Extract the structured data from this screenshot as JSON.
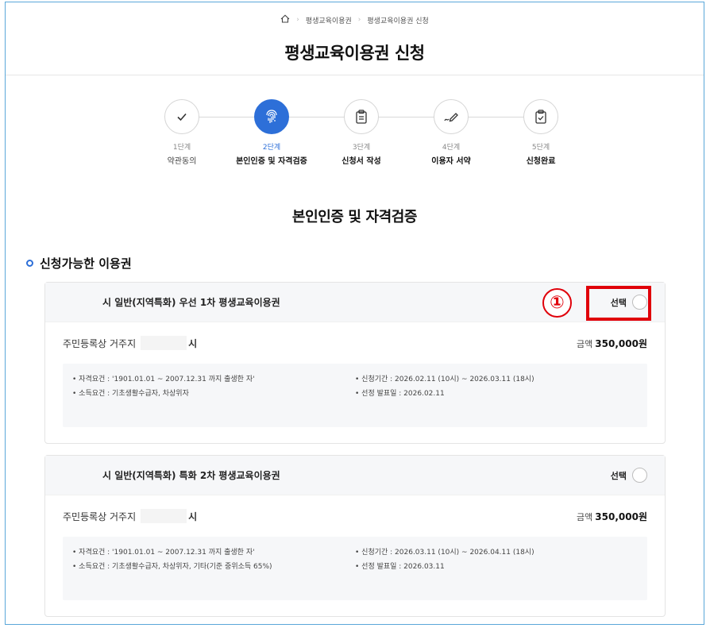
{
  "breadcrumb": {
    "items": [
      "평생교육이용권",
      "평생교육이용권 신청"
    ]
  },
  "page_title": "평생교육이용권 신청",
  "stepper": {
    "steps": [
      {
        "num": "1단계",
        "label": "약관동의",
        "icon": "check-icon",
        "state": "done"
      },
      {
        "num": "2단계",
        "label": "본인인증 및 자격검증",
        "icon": "fingerprint-icon",
        "state": "active"
      },
      {
        "num": "3단계",
        "label": "신청서 작성",
        "icon": "clipboard-icon",
        "state": "pending"
      },
      {
        "num": "4단계",
        "label": "이용자 서약",
        "icon": "pen-icon",
        "state": "pending"
      },
      {
        "num": "5단계",
        "label": "신청완료",
        "icon": "clipboard-check-icon",
        "state": "pending"
      }
    ]
  },
  "section_title": "본인인증 및 자격검증",
  "available_title": "신청가능한 이용권",
  "cards": [
    {
      "title": "시 일반(지역특화) 우선 1차 평생교육이용권",
      "select_label": "선택",
      "residence_label": "주민등록상 거주지",
      "residence_value": "시",
      "amount_label": "금액",
      "amount_value": "350,000원",
      "left_details": [
        "• 자격요건 : '1901.01.01 ~ 2007.12.31 까지 출생한 자'",
        "• 소득요건 : 기초생활수급자, 차상위자"
      ],
      "right_details": [
        "• 신청기간 : 2026.02.11 (10시) ~ 2026.03.11 (18시)",
        "• 선정 발표일 : 2026.02.11"
      ]
    },
    {
      "title": "시 일반(지역특화) 특화 2차 평생교육이용권",
      "select_label": "선택",
      "residence_label": "주민등록상 거주지",
      "residence_value": "시",
      "amount_label": "금액",
      "amount_value": "350,000원",
      "left_details": [
        "• 자격요건 : '1901.01.01 ~ 2007.12.31 까지 출생한 자'",
        "• 소득요건 : 기초생활수급자, 차상위자, 기타(기준 중위소득 65%)"
      ],
      "right_details": [
        "• 신청기간 : 2026.03.11 (10시) ~ 2026.04.11 (18시)",
        "• 선정 발표일 : 2026.03.11"
      ]
    }
  ],
  "annotation": {
    "marker": "①"
  },
  "colors": {
    "accent": "#2d6fd8",
    "annotation": "#e0000a",
    "frame": "#5aa7d9"
  }
}
